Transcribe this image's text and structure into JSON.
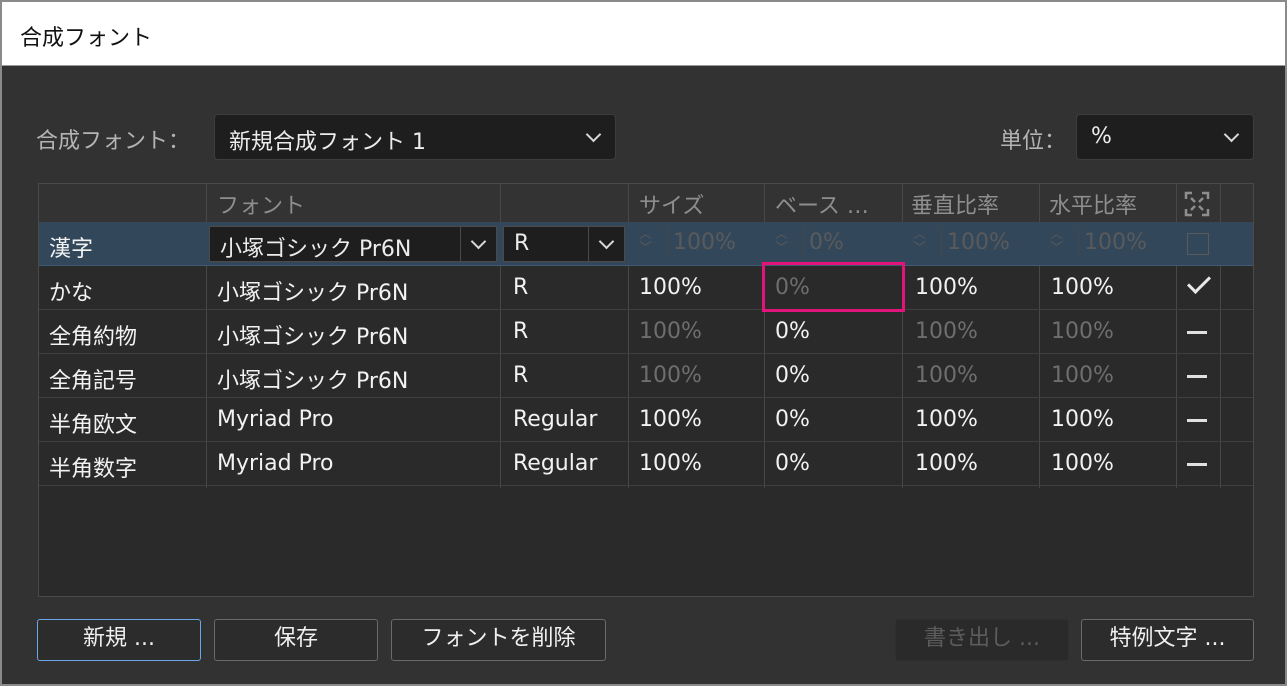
{
  "window": {
    "title": "合成フォント"
  },
  "composite_font": {
    "label": "合成フォント：",
    "value": "新規合成フォント 1"
  },
  "unit": {
    "label": "単位：",
    "value": "%"
  },
  "table": {
    "headers": {
      "font": "フォント",
      "size": "サイズ",
      "baseline": "ベース …",
      "vscale": "垂直比率",
      "hscale": "水平比率"
    },
    "rows": [
      {
        "name": "漢字",
        "font": "小塚ゴシック Pr6N",
        "style": "R",
        "size": "100%",
        "baseline": "0%",
        "vscale": "100%",
        "hscale": "100%",
        "mark": "checkbox",
        "selected": true
      },
      {
        "name": "かな",
        "font": "小塚ゴシック Pr6N",
        "style": "R",
        "size": "100%",
        "baseline": "0%",
        "vscale": "100%",
        "hscale": "100%",
        "mark": "check"
      },
      {
        "name": "全角約物",
        "font": "小塚ゴシック Pr6N",
        "style": "R",
        "size": "100%",
        "baseline": "0%",
        "vscale": "100%",
        "hscale": "100%",
        "mark": "dash"
      },
      {
        "name": "全角記号",
        "font": "小塚ゴシック Pr6N",
        "style": "R",
        "size": "100%",
        "baseline": "0%",
        "vscale": "100%",
        "hscale": "100%",
        "mark": "dash"
      },
      {
        "name": "半角欧文",
        "font": "Myriad Pro",
        "style": "Regular",
        "size": "100%",
        "baseline": "0%",
        "vscale": "100%",
        "hscale": "100%",
        "mark": "dash"
      },
      {
        "name": "半角数字",
        "font": "Myriad Pro",
        "style": "Regular",
        "size": "100%",
        "baseline": "0%",
        "vscale": "100%",
        "hscale": "100%",
        "mark": "dash"
      }
    ]
  },
  "buttons": {
    "new": "新規 ...",
    "save": "保存",
    "delete_font": "フォントを削除",
    "export": "書き出し ...",
    "exceptions": "特例文字 ..."
  },
  "colors": {
    "accent": "#6aa6e8",
    "highlight": "#e0147a",
    "selected_row": "#33475b"
  },
  "icons": {
    "header_scale": "fit-arrows-icon"
  }
}
